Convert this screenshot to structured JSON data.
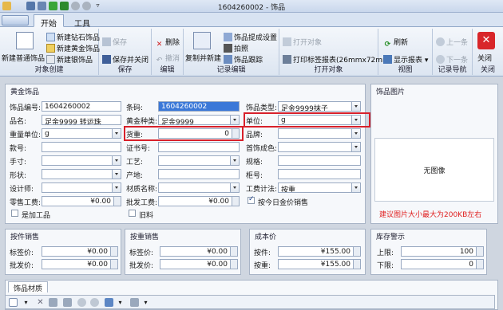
{
  "window": {
    "title": "1604260002 - 饰品"
  },
  "tabs": [
    {
      "label": "开始",
      "active": true
    },
    {
      "label": "工具",
      "active": false
    }
  ],
  "ribbon": {
    "groups": {
      "create": {
        "label": "对象创建",
        "new_normal": "新建普通饰品",
        "new_diamond": "新建钻石饰品",
        "new_gold": "新建黄金饰品",
        "new_silver": "新建银饰品"
      },
      "save": {
        "label": "保存",
        "save": "保存",
        "save_close": "保存并关闭"
      },
      "edit": {
        "label": "编辑",
        "delete": "删除",
        "cancel": "撤消"
      },
      "record": {
        "label": "记录编辑",
        "copy_new": "复制并新建",
        "settings": "饰品提成设置",
        "photo": "拍照",
        "track": "饰品跟踪"
      },
      "open": {
        "label": "打开对象",
        "open_obj": "打开对象",
        "print_tag": "打印标签报表(26mmx72mm)"
      },
      "view": {
        "label": "视图",
        "refresh": "刷新",
        "show_report": "显示报表"
      },
      "nav": {
        "label": "记录导航",
        "prev": "上一条",
        "next": "下一条"
      },
      "close": {
        "label": "关闭",
        "close": "关闭"
      }
    }
  },
  "gold_section": {
    "title": "黄金饰品",
    "fields": {
      "code_label": "饰品编号:",
      "code_value": "1604260002",
      "barcode_label": "条码:",
      "barcode_value": "1604260002",
      "type_label": "饰品类型:",
      "type_value": "足金9999抹子",
      "name_label": "品名:",
      "name_value": "足金9999 转运珠",
      "gold_type_label": "黄金种类:",
      "gold_type_value": "足金9999",
      "unit_label": "单位:",
      "unit_value": "g",
      "weight_unit_label": "重量单位:",
      "weight_unit_value": "g",
      "stock_label": "货重:",
      "stock_value": "0",
      "brand_label": "品牌:",
      "brand_value": "",
      "style_label": "款号:",
      "style_value": "",
      "cert_label": "证书号:",
      "cert_value": "",
      "color_label": "首饰成色:",
      "color_value": "",
      "size_label": "手寸:",
      "size_value": "",
      "craft_label": "工艺:",
      "craft_value": "",
      "spec_label": "规格:",
      "spec_value": "",
      "shape_label": "形状:",
      "shape_value": "",
      "origin_label": "产地:",
      "origin_value": "",
      "cabinet_label": "柜号:",
      "cabinet_value": "",
      "designer_label": "设计师:",
      "designer_value": "",
      "material_label": "材质名称:",
      "material_value": "",
      "fee_method_label": "工费计法:",
      "fee_method_value": "按重",
      "retail_fee_label": "零售工费:",
      "retail_fee_value": "¥0.00",
      "wholesale_fee_label": "批发工费:",
      "wholesale_fee_value": "¥0.00",
      "daily_price_label": "按今日金价销售",
      "is_processed_label": "是加工品",
      "old_label": "旧料"
    }
  },
  "image_section": {
    "title": "饰品图片",
    "empty_text": "无图像",
    "hint": "建议图片大小最大为200KB左右"
  },
  "piece_sales": {
    "title": "按件销售",
    "tag_label": "标签价:",
    "tag_value": "¥0.00",
    "wholesale_label": "批发价:",
    "wholesale_value": "¥0.00"
  },
  "weight_sales": {
    "title": "按重销售",
    "tag_label": "标签价:",
    "tag_value": "¥0.00",
    "wholesale_label": "批发价:",
    "wholesale_value": "¥0.00"
  },
  "cost": {
    "title": "成本价",
    "piece_label": "按件:",
    "piece_value": "¥155.00",
    "weight_label": "按重:",
    "weight_value": "¥155.00"
  },
  "stock_alert": {
    "title": "库存警示",
    "upper_label": "上限:",
    "upper_value": "100",
    "lower_label": "下限:",
    "lower_value": "0"
  },
  "material_tab": {
    "label": "饰品材质"
  },
  "colors": {
    "accent": "#3b78d8",
    "highlight_red": "#d8202a",
    "warning_red": "#e02020"
  }
}
